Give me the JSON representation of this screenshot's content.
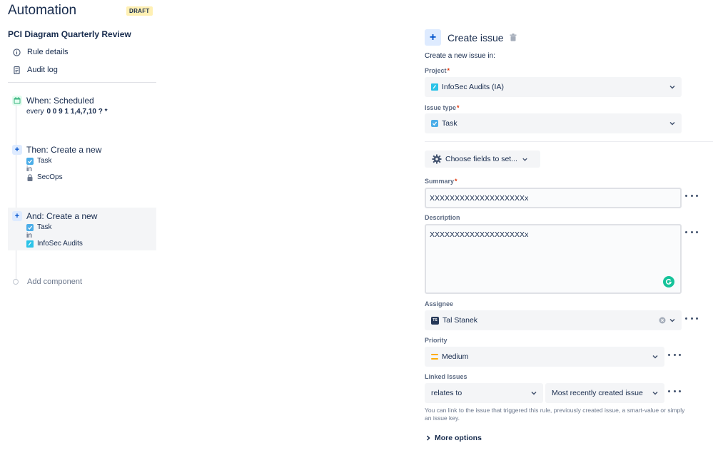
{
  "app": {
    "title": "Automation",
    "status_badge": "DRAFT"
  },
  "rule": {
    "name": "PCI Diagram Quarterly Review"
  },
  "nav": [
    {
      "label": "Rule details",
      "icon": "info-icon"
    },
    {
      "label": "Audit log",
      "icon": "log-icon"
    }
  ],
  "components": {
    "trigger": {
      "title": "When: Scheduled",
      "schedule_prefix": "every",
      "cron": "0 0 9 1 1,4,7,10 ? *"
    },
    "action1": {
      "title": "Then: Create a new",
      "issue_type": "Task",
      "in_label": "in",
      "project": "SecOps"
    },
    "action2": {
      "title": "And: Create a new",
      "issue_type": "Task",
      "in_label": "in",
      "project": "InfoSec Audits"
    },
    "add_component": "Add component"
  },
  "panel": {
    "title": "Create issue",
    "subtitle": "Create a new issue in:",
    "project": {
      "label": "Project",
      "value": "InfoSec Audits (IA)"
    },
    "issue_type": {
      "label": "Issue type",
      "value": "Task"
    },
    "choose_fields": "Choose fields to set...",
    "summary": {
      "label": "Summary",
      "value": "XXXXXXXXXXXXXXXXXXXx"
    },
    "description": {
      "label": "Description",
      "value": "XXXXXXXXXXXXXXXXXXXx"
    },
    "assignee": {
      "label": "Assignee",
      "value": "Tal Stanek",
      "initials": "TS"
    },
    "priority": {
      "label": "Priority",
      "value": "Medium"
    },
    "linked_issues": {
      "label": "Linked Issues",
      "relation": "relates to",
      "target": "Most recently created issue",
      "help": "You can link to the issue that triggered this rule, previously created issue, a smart-value or simply an issue key."
    },
    "more_options": "More options"
  },
  "colors": {
    "draft_bg": "#fff0b3",
    "task_blue": "#4bade8",
    "project_cyan": "#2bc3e8",
    "priority_medium": "#ffab00",
    "grammarly_green": "#15c39a",
    "required_red": "#de350b"
  }
}
